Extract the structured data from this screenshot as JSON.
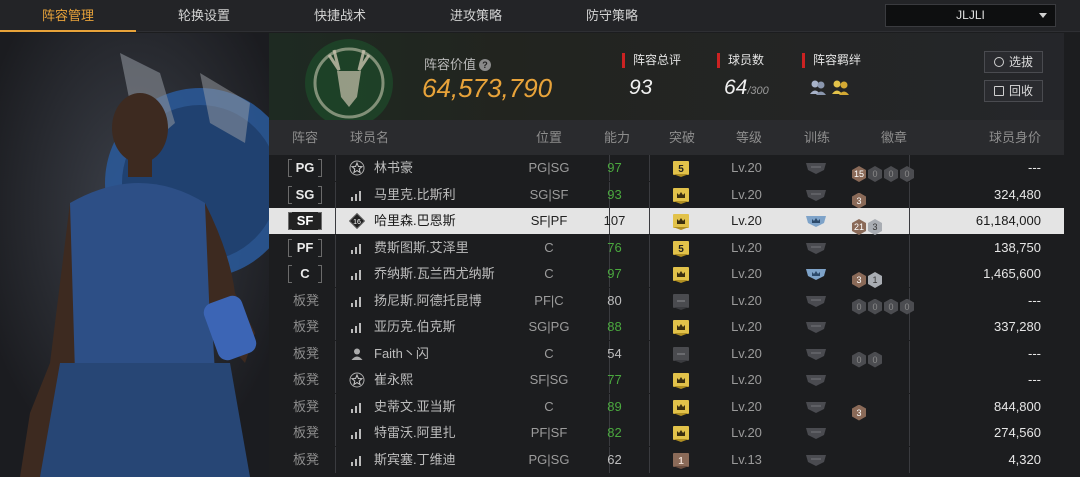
{
  "tabs": [
    "阵容管理",
    "轮换设置",
    "快捷战术",
    "进攻策略",
    "防守策略"
  ],
  "dropdown": {
    "value": "JLJLI"
  },
  "info": {
    "value_label": "阵容价值",
    "value": "64,573,790",
    "rating_label": "阵容总评",
    "rating": "93",
    "players_label": "球员数",
    "players": "64",
    "players_max": "/300",
    "bond_label": "阵容羁绊",
    "btn_select": "选拔",
    "btn_recycle": "回收"
  },
  "headers": {
    "lineup": "阵容",
    "name": "球员名",
    "position": "位置",
    "ability": "能力",
    "breakthrough": "突破",
    "level": "等级",
    "training": "训练",
    "badge": "徽章",
    "price": "球员身价"
  },
  "colors": {
    "accent": "#e8a33a",
    "green": "#4aa83e",
    "gold": "#e2c24a",
    "bronze": "#8a6a58"
  },
  "rows": [
    {
      "lineup": "PG",
      "starter": true,
      "name": "林书豪",
      "icon": "star-icon",
      "position": "PG|SG",
      "ability": "97",
      "ability_green": true,
      "brk": "5",
      "brk_type": "gold-num",
      "level": "Lv.20",
      "train": "gray",
      "badges": [
        [
          "15",
          "bronze"
        ],
        [
          "0",
          "dark"
        ],
        [
          "0",
          "dark"
        ],
        [
          "0",
          "dark"
        ]
      ],
      "price": "---"
    },
    {
      "lineup": "SG",
      "starter": true,
      "name": "马里克.比斯利",
      "icon": "signal-icon",
      "position": "SG|SF",
      "ability": "93",
      "ability_green": true,
      "brk": "",
      "brk_type": "gold-crown",
      "level": "Lv.20",
      "train": "gray",
      "badges": [
        [
          "3",
          "bronze"
        ]
      ],
      "price": "324,480"
    },
    {
      "lineup": "SF",
      "starter": true,
      "selected": true,
      "name": "哈里森.巴恩斯",
      "icon": "number-icon",
      "icon_text": "16",
      "position": "SF|PF",
      "ability": "107",
      "ability_green": false,
      "brk": "",
      "brk_type": "gold-crown",
      "level": "Lv.20",
      "train": "blue",
      "badges": [
        [
          "21",
          "bronze"
        ],
        [
          "3",
          "silver"
        ]
      ],
      "price": "61,184,000"
    },
    {
      "lineup": "PF",
      "starter": true,
      "name": "费斯图斯.艾泽里",
      "icon": "signal-icon",
      "position": "C",
      "ability": "76",
      "ability_green": true,
      "brk": "5",
      "brk_type": "gold-num",
      "level": "Lv.20",
      "train": "gray",
      "badges": [],
      "price": "138,750"
    },
    {
      "lineup": "C",
      "starter": true,
      "name": "乔纳斯.瓦兰西尤纳斯",
      "icon": "signal-icon",
      "position": "C",
      "ability": "97",
      "ability_green": true,
      "brk": "",
      "brk_type": "gold-crown",
      "level": "Lv.20",
      "train": "blue",
      "badges": [
        [
          "3",
          "bronze"
        ],
        [
          "1",
          "silver"
        ]
      ],
      "price": "1,465,600"
    },
    {
      "lineup": "板凳",
      "starter": false,
      "name": "扬尼斯.阿德托昆博",
      "icon": "signal-icon",
      "position": "PF|C",
      "ability": "80",
      "ability_green": false,
      "brk": "",
      "brk_type": "gray",
      "level": "Lv.20",
      "train": "gray",
      "badges": [
        [
          "0",
          "dark"
        ],
        [
          "0",
          "dark"
        ],
        [
          "0",
          "dark"
        ],
        [
          "0",
          "dark"
        ]
      ],
      "price": "---"
    },
    {
      "lineup": "板凳",
      "starter": false,
      "name": "亚历克.伯克斯",
      "icon": "signal-icon",
      "position": "SG|PG",
      "ability": "88",
      "ability_green": true,
      "brk": "",
      "brk_type": "gold-crown",
      "level": "Lv.20",
      "train": "gray",
      "badges": [],
      "price": "337,280"
    },
    {
      "lineup": "板凳",
      "starter": false,
      "name": "Faith丶闪",
      "icon": "person-icon",
      "position": "C",
      "ability": "54",
      "ability_green": false,
      "brk": "",
      "brk_type": "gray",
      "level": "Lv.20",
      "train": "gray",
      "badges": [
        [
          "0",
          "dark"
        ],
        [
          "0",
          "dark"
        ]
      ],
      "price": "---"
    },
    {
      "lineup": "板凳",
      "starter": false,
      "name": "崔永熙",
      "icon": "star-icon",
      "position": "SF|SG",
      "ability": "77",
      "ability_green": true,
      "brk": "",
      "brk_type": "gold-crown",
      "level": "Lv.20",
      "train": "gray",
      "badges": [],
      "price": "---"
    },
    {
      "lineup": "板凳",
      "starter": false,
      "name": "史蒂文.亚当斯",
      "icon": "signal-icon",
      "position": "C",
      "ability": "89",
      "ability_green": true,
      "brk": "",
      "brk_type": "gold-crown",
      "level": "Lv.20",
      "train": "gray",
      "badges": [
        [
          "3",
          "bronze"
        ]
      ],
      "price": "844,800"
    },
    {
      "lineup": "板凳",
      "starter": false,
      "name": "特雷沃.阿里扎",
      "icon": "signal-icon",
      "position": "PF|SF",
      "ability": "82",
      "ability_green": true,
      "brk": "",
      "brk_type": "gold-crown",
      "level": "Lv.20",
      "train": "gray",
      "badges": [],
      "price": "274,560"
    },
    {
      "lineup": "板凳",
      "starter": false,
      "name": "斯宾塞.丁维迪",
      "icon": "signal-icon",
      "position": "PG|SG",
      "ability": "62",
      "ability_green": false,
      "brk": "1",
      "brk_type": "bronze-num",
      "level": "Lv.13",
      "train": "gray",
      "badges": [],
      "price": "4,320"
    }
  ]
}
